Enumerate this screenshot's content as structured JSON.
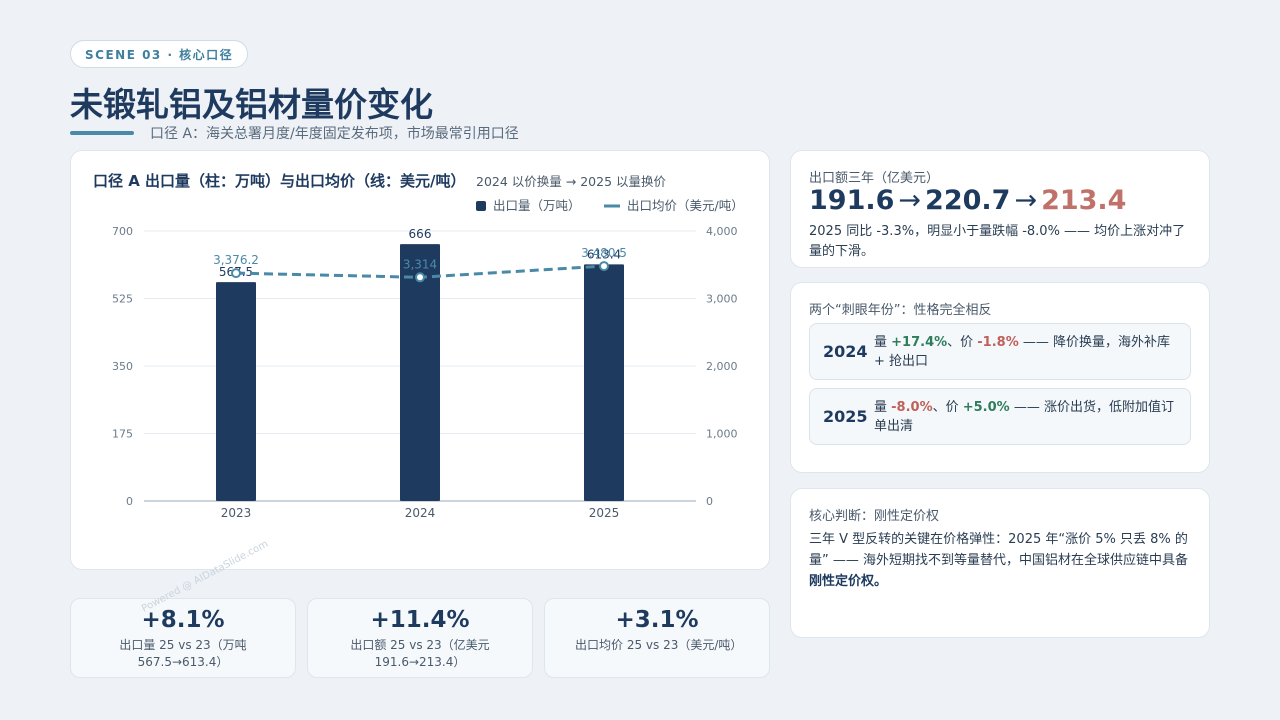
{
  "header": {
    "scene_tag": "SCENE 03 · 核心口径",
    "title": "未锻轧铝及铝材量价变化",
    "subtitle": "口径 A：海关总署月度/年度固定发布项，市场最常引用口径"
  },
  "chart_card": {
    "title": "口径 A 出口量（柱：万吨）与出口均价（线：美元/吨）",
    "subtitle": "2024 以价换量 → 2025 以量换价"
  },
  "chart_data": {
    "type": "bar",
    "categories": [
      "2023",
      "2024",
      "2025"
    ],
    "series": [
      {
        "name": "出口量（万吨）",
        "kind": "bar",
        "axis": "left",
        "values": [
          567.5,
          666,
          613.4
        ],
        "labels": [
          "567.5",
          "666",
          "613.4"
        ],
        "color": "#1e3a5f"
      },
      {
        "name": "出口均价（美元/吨）",
        "kind": "line",
        "axis": "right",
        "values": [
          3376.2,
          3314,
          3480.5
        ],
        "labels": [
          "3,376.2",
          "3,314",
          "3,480.5"
        ],
        "color": "#4a8aa8"
      }
    ],
    "ylim_left": [
      0,
      700
    ],
    "yticks_left": [
      "0",
      "175",
      "350",
      "525",
      "700"
    ],
    "ylim_right": [
      0,
      4000
    ],
    "yticks_right": [
      "0",
      "1,000",
      "2,000",
      "3,000",
      "4,000"
    ],
    "grid": true,
    "legend": "top-right"
  },
  "kpis": [
    {
      "value": "+8.1%",
      "label": "出口量 25 vs 23（万吨 567.5→613.4）"
    },
    {
      "value": "+11.4%",
      "label": "出口额 25 vs 23（亿美元 191.6→213.4）"
    },
    {
      "value": "+3.1%",
      "label": "出口均价 25 vs 23（美元/吨）"
    }
  ],
  "export_card": {
    "heading": "出口额三年（亿美元）",
    "v1": "191.6",
    "v2": "220.7",
    "v3": "213.4",
    "arrow": "→",
    "text": "2025 同比 -3.3%，明显小于量跌幅 -8.0% —— 均价上涨对冲了量的下滑。"
  },
  "years_card": {
    "heading": "两个“刺眼年份”：性格完全相反",
    "y2024": {
      "year": "2024",
      "p1": "量 ",
      "v1": "+17.4%",
      "p2": "、价 ",
      "v2": "-1.8%",
      "p3": " —— 降价换量，海外补库 + 抢出口"
    },
    "y2025": {
      "year": "2025",
      "p1": "量 ",
      "v1": "-8.0%",
      "p2": "、价 ",
      "v2": "+5.0%",
      "p3": " —— 涨价出货，低附加值订单出清"
    }
  },
  "judgement_card": {
    "heading": "核心判断：刚性定价权",
    "text": "三年 V 型反转的关键在价格弹性：2025 年“涨价 5% 只丢 8% 的量” —— 海外短期找不到等量替代，中国铝材在全球供应链中具备",
    "bold": "刚性定价权。"
  },
  "colors": {
    "navy": "#1e3a5f",
    "teal": "#4a8aa8",
    "green": "#2e7d5b",
    "red": "#c0605a"
  },
  "watermark": "Powered @ AIDataSlide.com"
}
